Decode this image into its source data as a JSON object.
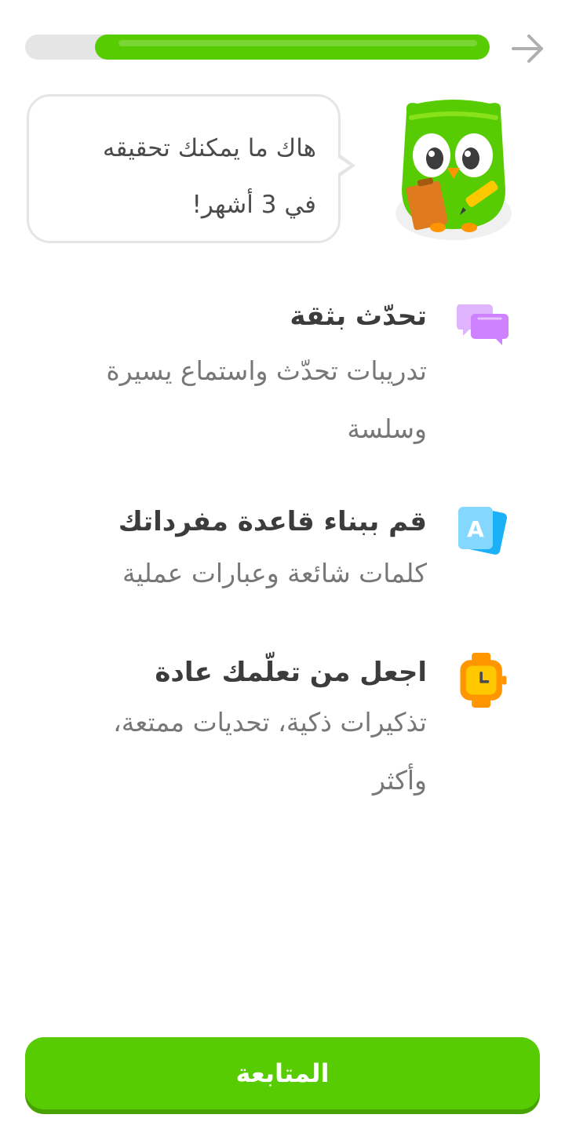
{
  "header": {
    "back_icon": "arrow-right-icon",
    "progress_fraction": 0.85
  },
  "bubble": {
    "text_line1": "هاك ما يمكنك تحقيقه",
    "text_line2": "في 3 أشهر!"
  },
  "mascot": {
    "icon": "duo-owl-mascot",
    "color": "#58cc02"
  },
  "features": [
    {
      "icon": "chat-bubbles-icon",
      "title": "تحدّث بثقة",
      "description_line1": "تدريبات تحدّث واستماع يسيرة",
      "description_line2": "وسلسة"
    },
    {
      "icon": "vocabulary-cards-icon",
      "title": "قم ببناء قاعدة مفرداتك",
      "description_line1": "كلمات شائعة وعبارات عملية"
    },
    {
      "icon": "watch-icon",
      "title": "اجعل من تعلّمك عادة",
      "description_line1": "تذكيرات ذكية، تحديات ممتعة،",
      "description_line2": "وأكثر"
    }
  ],
  "footer": {
    "continue_label": "المتابعة"
  },
  "colors": {
    "brand_green": "#58cc02",
    "track_gray": "#e5e5e5",
    "text_dark": "#3c3c3c",
    "text_muted": "#777777"
  }
}
